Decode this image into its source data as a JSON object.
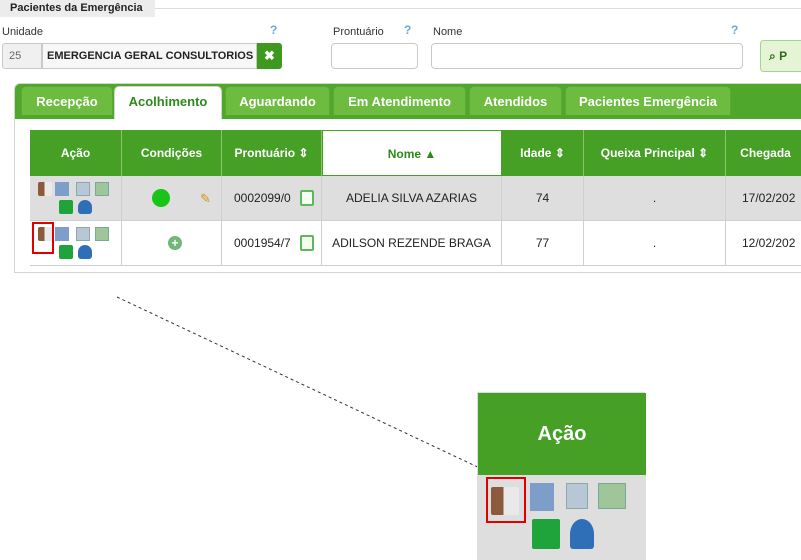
{
  "section": {
    "title": "Pacientes da Emergência"
  },
  "filters": {
    "unidade_label": "Unidade",
    "unidade_code": "25",
    "unidade_name": "EMERGENCIA GERAL CONSULTORIOS",
    "clear_icon": "x-icon",
    "prontuario_label": "Prontuário",
    "prontuario_value": "",
    "nome_label": "Nome",
    "nome_value": "",
    "help_mark": "?",
    "search_label": "P",
    "search_icon": "search-icon"
  },
  "tabs": [
    {
      "label": "Recepção"
    },
    {
      "label": "Acolhimento"
    },
    {
      "label": "Aguardando"
    },
    {
      "label": "Em Atendimento"
    },
    {
      "label": "Atendidos"
    },
    {
      "label": "Pacientes Emergência"
    }
  ],
  "active_tab": "Acolhimento",
  "table": {
    "columns": [
      {
        "label": "Ação",
        "sort": ""
      },
      {
        "label": "Condições",
        "sort": ""
      },
      {
        "label": "Prontuário",
        "sort": "⇕"
      },
      {
        "label": "Nome",
        "sort": "▲"
      },
      {
        "label": "Idade",
        "sort": "⇕"
      },
      {
        "label": "Queixa Principal",
        "sort": "⇕"
      },
      {
        "label": "Chegada",
        "sort": ""
      }
    ],
    "rows": [
      {
        "condicao": "green-dot-icon",
        "prontuario": "0002099/0",
        "nome": "ADELIA SILVA AZARIAS",
        "idade": "74",
        "queixa": ".",
        "chegada": "17/02/202"
      },
      {
        "condicao": "add-circle-icon",
        "prontuario": "0001954/7",
        "nome": "ADILSON REZENDE BRAGA",
        "idade": "77",
        "queixa": ".",
        "chegada": "12/02/202"
      }
    ],
    "action_icons": [
      "nurse-icon",
      "document-add-icon",
      "bed-icon",
      "money-document-icon",
      "printer-icon",
      "person-icon"
    ]
  },
  "zoom": {
    "title": "Ação"
  },
  "colors": {
    "green": "#46a026",
    "tab_green": "#6dbb3f",
    "highlight": "#e00000"
  }
}
